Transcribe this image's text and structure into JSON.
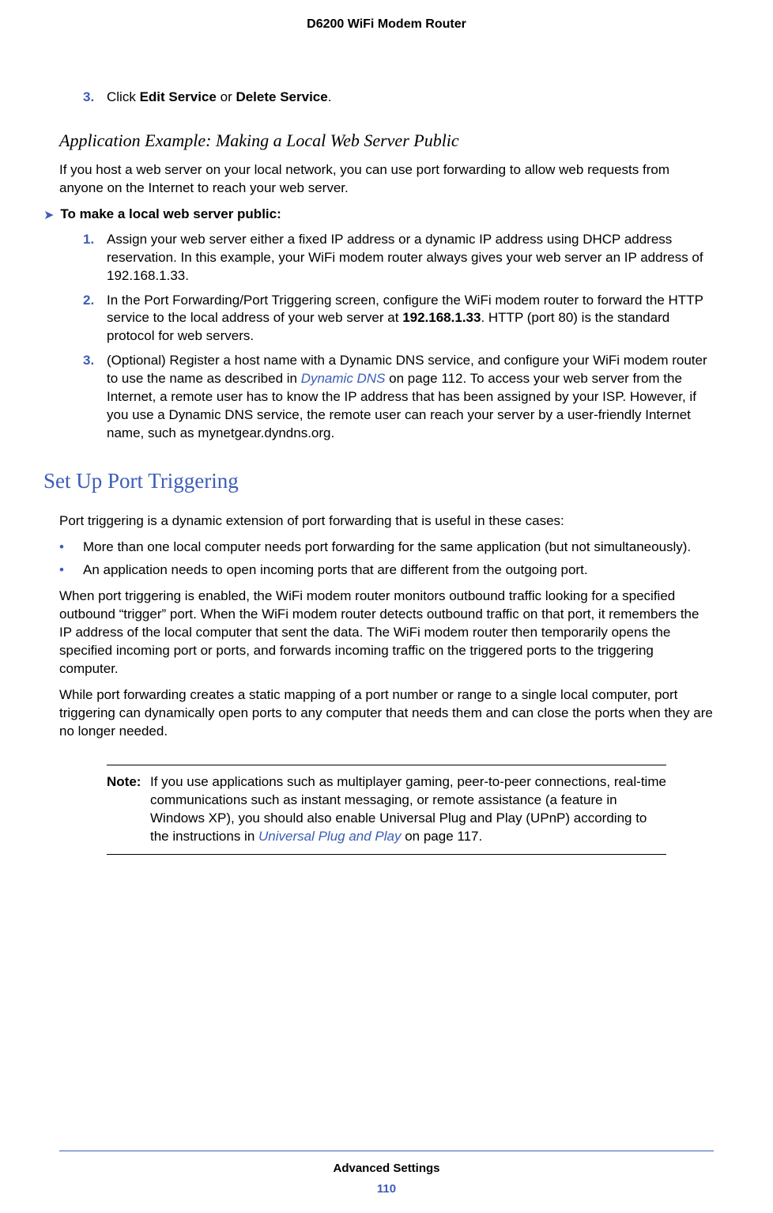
{
  "header": {
    "title": "D6200 WiFi Modem Router"
  },
  "step3": {
    "number": "3.",
    "prefix": "Click ",
    "bold1": "Edit Service",
    "mid": " or ",
    "bold2": "Delete Service",
    "suffix": "."
  },
  "subheading1": "Application Example: Making a Local Web Server Public",
  "para1": "If you host a web server on your local network, you can use port forwarding to allow web requests from anyone on the Internet to reach your web server.",
  "procHeading": "To make a local web server public:",
  "procSteps": {
    "s1": {
      "number": "1.",
      "text": "Assign your web server either a fixed IP address or a dynamic IP address using DHCP address reservation. In this example, your WiFi modem router always gives your web server an IP address of 192.168.1.33."
    },
    "s2": {
      "number": "2.",
      "prefix": "In the Port Forwarding/Port Triggering screen, configure the WiFi modem router to forward the HTTP service to the local address of your web server at ",
      "bold": "192.168.1.33",
      "suffix": ". HTTP (port 80) is the standard protocol for web servers."
    },
    "s3": {
      "number": "3.",
      "prefix": "(Optional) Register a host name with a Dynamic DNS service, and configure your WiFi modem router to use the name as described in ",
      "link": "Dynamic DNS",
      "suffix": " on page 112. To access your web server from the Internet, a remote user has to know the IP address that has been assigned by your ISP. However, if you use a Dynamic DNS service, the remote user can reach your server by a user-friendly Internet name, such as mynetgear.dyndns.org."
    }
  },
  "sectionHeading": "Set Up Port Triggering",
  "para2": "Port triggering is a dynamic extension of port forwarding that is useful in these cases:",
  "bullets": {
    "b1": "More than one local computer needs port forwarding for the same application (but not simultaneously).",
    "b2": "An application needs to open incoming ports that are different from the outgoing port."
  },
  "para3": "When port triggering is enabled, the WiFi modem router monitors outbound traffic looking for a specified outbound “trigger” port. When the WiFi modem router detects outbound traffic on that port, it remembers the IP address of the local computer that sent the data. The WiFi modem router then temporarily opens the specified incoming port or ports, and forwards incoming traffic on the triggered ports to the triggering computer.",
  "para4": "While port forwarding creates a static mapping of a port number or range to a single local computer, port triggering can dynamically open ports to any computer that needs them and can close the ports when they are no longer needed.",
  "note": {
    "label": "Note:",
    "prefix": "If you use applications such as multiplayer gaming, peer-to-peer connections, real-time communications such as instant messaging, or remote assistance (a feature in Windows XP), you should also enable Universal Plug and Play (UPnP) according to the instructions in ",
    "link": "Universal Plug and Play",
    "suffix": " on page 117."
  },
  "footer": {
    "section": "Advanced Settings",
    "page": "110"
  },
  "bulletChar": "•",
  "arrowChar": "➤"
}
